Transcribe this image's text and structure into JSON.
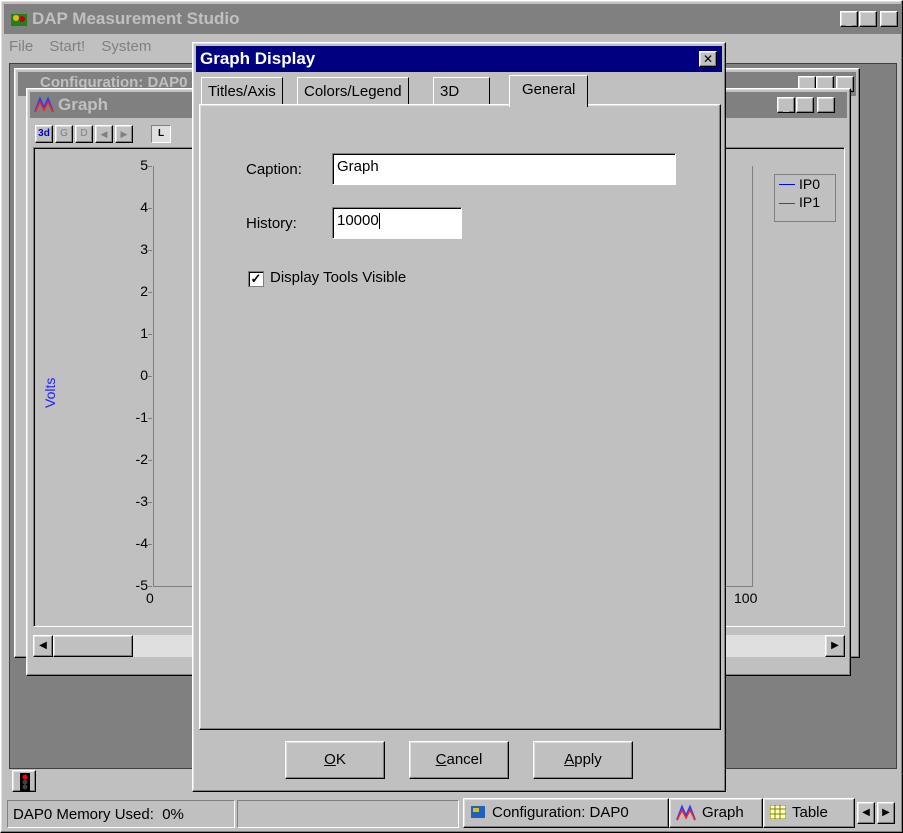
{
  "app": {
    "title": "DAP Measurement Studio"
  },
  "menu": [
    "File",
    "Start!",
    "System"
  ],
  "config_window": {
    "title": "Configuration: DAP0"
  },
  "graph_window": {
    "title": "Graph",
    "toolbar": [
      "3d",
      "G",
      "D",
      "L"
    ],
    "ylabel": "Volts",
    "yticks": [
      "5",
      "4",
      "3",
      "2",
      "1",
      "0",
      "-1",
      "-2",
      "-3",
      "-4",
      "-5"
    ],
    "xticks": [
      "0",
      "100"
    ],
    "legend": [
      {
        "name": "IP0",
        "color": "#0000ff"
      },
      {
        "name": "IP1",
        "color": "#ff0000"
      }
    ]
  },
  "dialog": {
    "title": "Graph Display",
    "tabs": [
      "Titles/Axis",
      "Colors/Legend",
      "3D",
      "General"
    ],
    "active_tab": "General",
    "caption_label": "Caption:",
    "caption_value": "Graph",
    "history_label": "History:",
    "history_value": "10000",
    "checkbox_label": "Display Tools Visible",
    "checkbox_checked": true,
    "buttons": {
      "ok_pre": "",
      "ok_u": "O",
      "ok_post": "K",
      "cancel_pre": "",
      "cancel_u": "C",
      "cancel_post": "ancel",
      "apply_pre": "",
      "apply_u": "A",
      "apply_post": "pply"
    }
  },
  "statusbar": {
    "memory": "DAP0 Memory Used:  0%",
    "tasks": [
      "Configuration: DAP0",
      "Graph",
      "Table"
    ]
  },
  "colors": {
    "active_title": "#000080",
    "face": "#c0c0c0",
    "workspace": "#808080"
  }
}
